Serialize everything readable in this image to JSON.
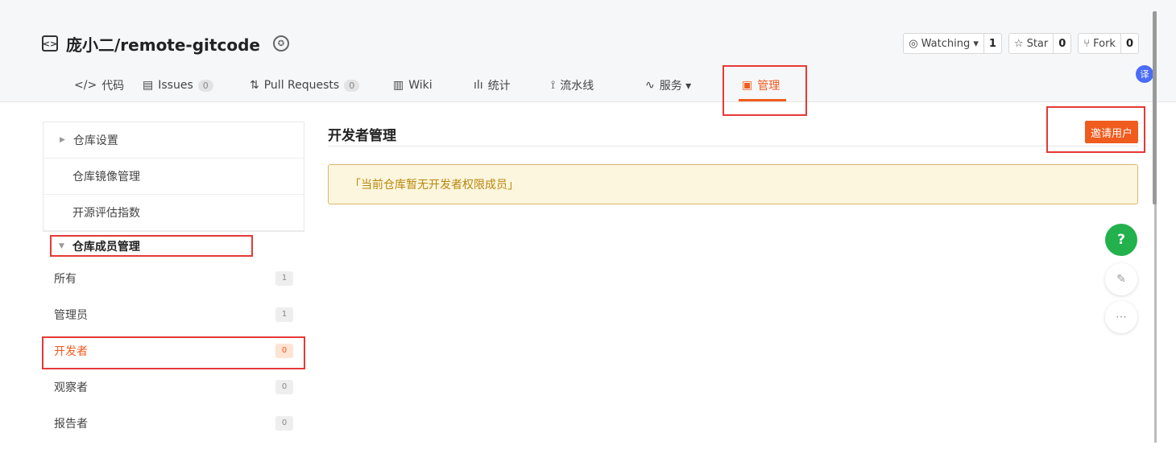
{
  "repo": {
    "icon_glyph": "<>",
    "name": "庞小二/remote-gitcode"
  },
  "actions": {
    "watching_label": "Watching ▾",
    "watching_count": "1",
    "star_label": "Star",
    "star_count": "0",
    "fork_label": "Fork",
    "fork_count": "0"
  },
  "tabs": [
    {
      "icon": "</>",
      "label": "代码"
    },
    {
      "icon": "▤",
      "label": "Issues",
      "count": "0"
    },
    {
      "icon": "⇅",
      "label": "Pull Requests",
      "count": "0"
    },
    {
      "icon": "▥",
      "label": "Wiki"
    },
    {
      "icon": "ılı",
      "label": "统计"
    },
    {
      "icon": "⟟",
      "label": "流水线"
    },
    {
      "icon": "∿",
      "label": "服务 ▾"
    },
    {
      "icon": "▣",
      "label": "管理"
    }
  ],
  "translate_glyph": "译",
  "sidebar": {
    "top_items": [
      "仓库设置",
      "仓库镜像管理",
      "开源评估指数"
    ],
    "section_title": "仓库成员管理",
    "members": [
      {
        "label": "所有",
        "count": "1"
      },
      {
        "label": "管理员",
        "count": "1"
      },
      {
        "label": "开发者",
        "count": "0"
      },
      {
        "label": "观察者",
        "count": "0"
      },
      {
        "label": "报告者",
        "count": "0"
      }
    ]
  },
  "main": {
    "title": "开发者管理",
    "invite_label": "邀请用户",
    "notice": "「当前仓库暂无开发者权限成员」"
  },
  "floating": {
    "help_glyph": "?",
    "edit_glyph": "✎",
    "chat_glyph": "⋯"
  },
  "colors": {
    "accent": "#f05b1e",
    "highlight": "#e53935",
    "help": "#22b14c"
  }
}
